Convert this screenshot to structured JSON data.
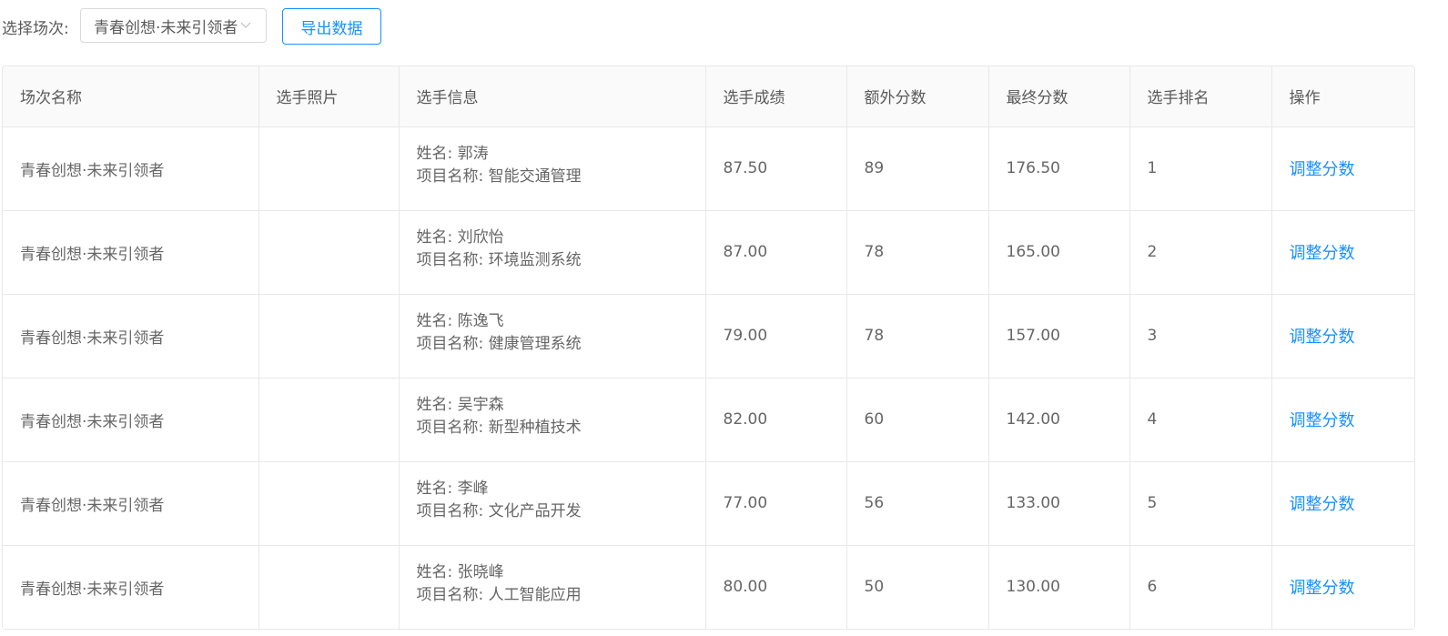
{
  "filter": {
    "label": "选择场次:",
    "selected": "青春创想·未来引领者",
    "arrow_icon": "chevron-down-icon"
  },
  "export_button": "导出数据",
  "colors": {
    "primary": "#1890ff",
    "text": "#595959",
    "border": "#e8e8e8",
    "header_bg": "#fafafa"
  },
  "table": {
    "headers": [
      "场次名称",
      "选手照片",
      "选手信息",
      "选手成绩",
      "额外分数",
      "最终分数",
      "选手排名",
      "操作"
    ],
    "name_prefix": "姓名: ",
    "project_prefix": "项目名称: ",
    "rows": [
      {
        "session": "青春创想·未来引领者",
        "photo": "",
        "name": "郭涛",
        "project": "智能交通管理",
        "score": "87.50",
        "extra": "89",
        "final": "176.50",
        "rank": "1",
        "action": "调整分数"
      },
      {
        "session": "青春创想·未来引领者",
        "photo": "",
        "name": "刘欣怡",
        "project": "环境监测系统",
        "score": "87.00",
        "extra": "78",
        "final": "165.00",
        "rank": "2",
        "action": "调整分数"
      },
      {
        "session": "青春创想·未来引领者",
        "photo": "",
        "name": "陈逸飞",
        "project": "健康管理系统",
        "score": "79.00",
        "extra": "78",
        "final": "157.00",
        "rank": "3",
        "action": "调整分数"
      },
      {
        "session": "青春创想·未来引领者",
        "photo": "",
        "name": "吴宇森",
        "project": "新型种植技术",
        "score": "82.00",
        "extra": "60",
        "final": "142.00",
        "rank": "4",
        "action": "调整分数"
      },
      {
        "session": "青春创想·未来引领者",
        "photo": "",
        "name": "李峰",
        "project": "文化产品开发",
        "score": "77.00",
        "extra": "56",
        "final": "133.00",
        "rank": "5",
        "action": "调整分数"
      },
      {
        "session": "青春创想·未来引领者",
        "photo": "",
        "name": "张晓峰",
        "project": "人工智能应用",
        "score": "80.00",
        "extra": "50",
        "final": "130.00",
        "rank": "6",
        "action": "调整分数"
      }
    ]
  }
}
